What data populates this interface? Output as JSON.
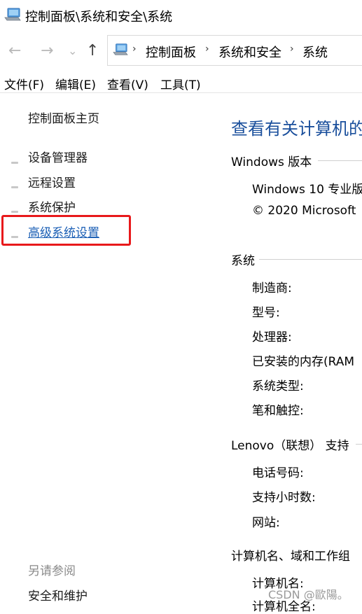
{
  "window": {
    "title": "控制面板\\系统和安全\\系统"
  },
  "nav": {
    "back_glyph": "←",
    "forward_glyph": "→",
    "recent_glyph": "⌄",
    "up_glyph": "↑",
    "breadcrumb": [
      "控制面板",
      "系统和安全",
      "系统"
    ],
    "separator": "›"
  },
  "menu": [
    "文件(F)",
    "编辑(E)",
    "查看(V)",
    "工具(T)"
  ],
  "sidebar": {
    "home": "控制面板主页",
    "links": [
      "设备管理器",
      "远程设置",
      "系统保护",
      "高级系统设置"
    ],
    "see_also_title": "另请参阅",
    "see_also": [
      "安全和维护"
    ]
  },
  "main": {
    "heading": "查看有关计算机的",
    "windows_section": {
      "title": "Windows 版本",
      "edition": "Windows 10 专业版",
      "copyright": "© 2020 Microsoft"
    },
    "system_section": {
      "title": "系统",
      "rows": [
        "制造商:",
        "型号:",
        "处理器:",
        "已安装的内存(RAM",
        "系统类型:",
        "笔和触控:"
      ]
    },
    "support_section": {
      "title": "Lenovo（联想） 支持",
      "rows": [
        "电话号码:",
        "支持小时数:",
        "网站:"
      ]
    },
    "computer_section": {
      "title": "计算机名、域和工作组",
      "rows": [
        "计算机名:",
        "计算机全名:"
      ]
    }
  },
  "watermark": "CSDN @歐陽。",
  "colors": {
    "heading_blue": "#1a4f9c",
    "link_blue": "#1b5fb5",
    "annotation_red": "#e8191b"
  }
}
